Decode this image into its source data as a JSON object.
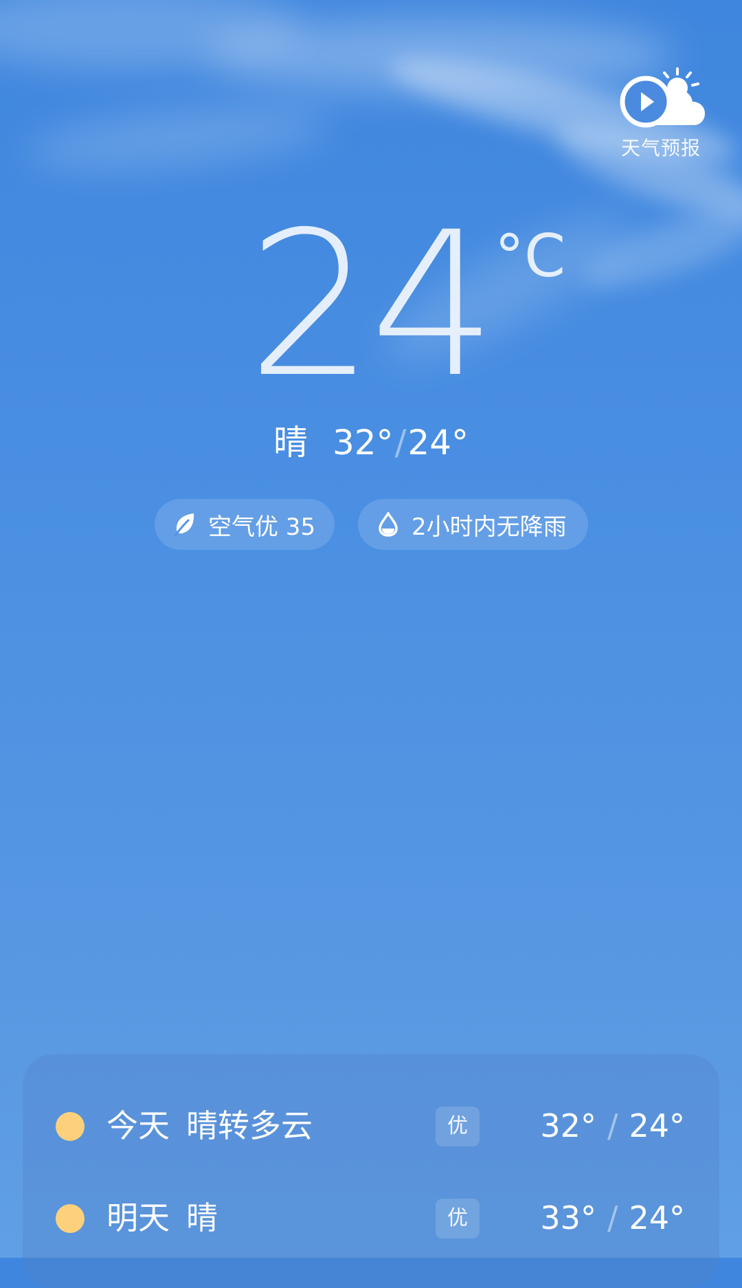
{
  "current": {
    "temperature": "24",
    "unit": "°C",
    "condition": "晴",
    "high": "32°",
    "low": "24°"
  },
  "forecast_video": {
    "label": "天气预报",
    "icon": "play-cloud-sun-icon"
  },
  "chips": {
    "air": {
      "icon": "leaf-icon",
      "label": "空气优 35"
    },
    "rain": {
      "icon": "raindrop-icon",
      "label": "2小时内无降雨"
    }
  },
  "forecast": [
    {
      "day": "今天",
      "condition": "晴转多云",
      "aqi": "优",
      "high": "32°",
      "low": "24°",
      "icon": "sun-icon",
      "icon_color": "#fdd17c"
    },
    {
      "day": "明天",
      "condition": "晴",
      "aqi": "优",
      "high": "33°",
      "low": "24°",
      "icon": "sun-icon",
      "icon_color": "#fdd17c"
    }
  ],
  "colors": {
    "sky_top": "#3f86de",
    "sky_bottom": "#609fe5",
    "sun": "#fdd17c"
  }
}
